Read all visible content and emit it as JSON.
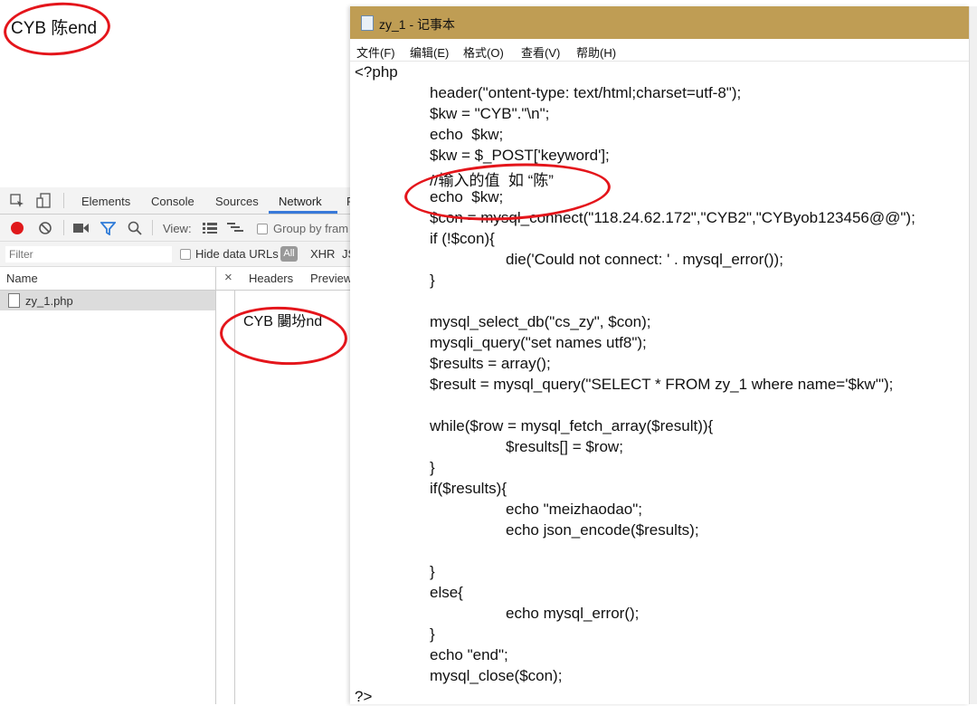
{
  "page": {
    "body_text": "CYB 陈end"
  },
  "devtools": {
    "tabs": [
      "Elements",
      "Console",
      "Sources",
      "Network",
      "P"
    ],
    "active_tab": "Network",
    "toolbar": {
      "view_label": "View:",
      "group_by_frame": "Group by fram"
    },
    "filter": {
      "placeholder": "Filter",
      "hide_data_urls": "Hide data URLs",
      "all": "All",
      "xhr": "XHR",
      "js": "JS"
    },
    "name_header": "Name",
    "files": [
      "zy_1.php"
    ],
    "detail_tabs": {
      "close": "×",
      "headers": "Headers",
      "preview": "Preview"
    },
    "preview_text": "CYB 闄坋nd"
  },
  "notepad": {
    "title": "zy_1 - 记事本",
    "menu": [
      "文件(F)",
      "编辑(E)",
      "格式(O)",
      "查看(V)",
      "帮助(H)"
    ],
    "code_lines": [
      {
        "indent": 0,
        "text": "<?php"
      },
      {
        "indent": 1,
        "text": "header(\"ontent-type: text/html;charset=utf-8\");"
      },
      {
        "indent": 1,
        "text": "$kw = \"CYB\".\"\\n\";"
      },
      {
        "indent": 1,
        "text": "echo  $kw;"
      },
      {
        "indent": 1,
        "text": "$kw = $_POST['keyword'];"
      },
      {
        "indent": 1,
        "text": "//输入的值  如 “陈”"
      },
      {
        "indent": 1,
        "text": "echo  $kw;"
      },
      {
        "indent": 1,
        "text": "$con = mysql_connect(\"118.24.62.172\",\"CYB2\",\"CYByob123456@@\");"
      },
      {
        "indent": 1,
        "text": "if (!$con){"
      },
      {
        "indent": 2,
        "text": "die('Could not connect: ' . mysql_error());"
      },
      {
        "indent": 1,
        "text": "}"
      },
      {
        "indent": 1,
        "text": ""
      },
      {
        "indent": 1,
        "text": "mysql_select_db(\"cs_zy\", $con);"
      },
      {
        "indent": 1,
        "text": "mysqli_query(\"set names utf8\");"
      },
      {
        "indent": 1,
        "text": "$results = array();"
      },
      {
        "indent": 1,
        "text": "$result = mysql_query(\"SELECT * FROM zy_1 where name='$kw'\");"
      },
      {
        "indent": 1,
        "text": ""
      },
      {
        "indent": 1,
        "text": "while($row = mysql_fetch_array($result)){"
      },
      {
        "indent": 2,
        "text": "$results[] = $row;"
      },
      {
        "indent": 1,
        "text": "}"
      },
      {
        "indent": 1,
        "text": "if($results){"
      },
      {
        "indent": 2,
        "text": "echo \"meizhaodao\";"
      },
      {
        "indent": 2,
        "text": "echo json_encode($results);"
      },
      {
        "indent": 1,
        "text": ""
      },
      {
        "indent": 1,
        "text": "}"
      },
      {
        "indent": 1,
        "text": "else{"
      },
      {
        "indent": 2,
        "text": "echo mysql_error();"
      },
      {
        "indent": 1,
        "text": "}"
      },
      {
        "indent": 1,
        "text": "echo \"end\";"
      },
      {
        "indent": 1,
        "text": "mysql_close($con);"
      },
      {
        "indent": 0,
        "text": "?>"
      }
    ]
  },
  "colors": {
    "annotation_red": "#e4151b",
    "notepad_titlebar": "#bf9d54",
    "devtools_active_tab": "#3879d9",
    "record_red": "#e0191b",
    "filter_blue": "#2f7bd8"
  }
}
